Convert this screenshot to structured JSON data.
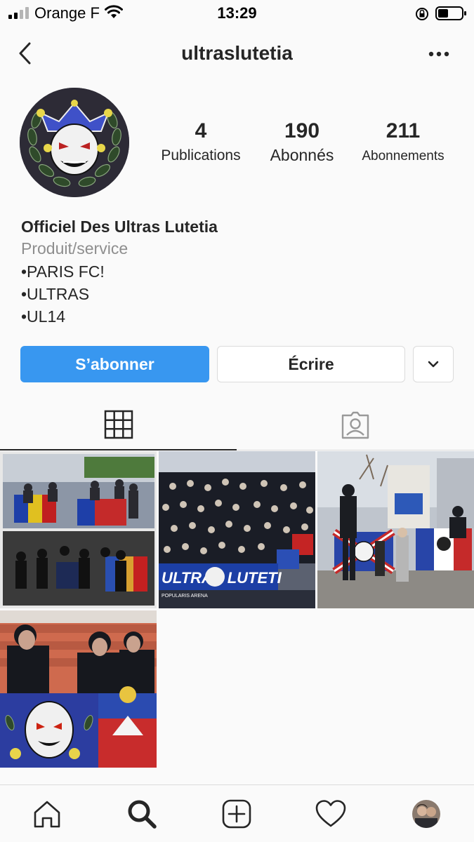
{
  "status_bar": {
    "carrier": "Orange F",
    "time": "13:29"
  },
  "header": {
    "username": "ultraslutetia"
  },
  "profile": {
    "stats": [
      {
        "value": "4",
        "label": "Publications"
      },
      {
        "value": "190",
        "label": "Abonnés"
      },
      {
        "value": "211",
        "label": "Abonnements"
      }
    ],
    "name": "Officiel Des Ultras Lutetia",
    "category": "Produit/service",
    "bio_lines": [
      "•PARIS FC!",
      "•ULTRAS",
      "•UL14"
    ]
  },
  "actions": {
    "follow_label": "S’abonner",
    "message_label": "Écrire"
  },
  "posts": {
    "post_2_banner_text": "ULTRAS LUTETI",
    "post_2_banner_subtext": "POPULARIS ARENA"
  },
  "colors": {
    "accent": "#3897f0",
    "border": "#dbdbdb",
    "text": "#262626",
    "muted": "#8e8e8e"
  },
  "icons": {
    "back": "chevron-left-icon",
    "more": "more-horizontal-icon",
    "grid_tab": "grid-icon",
    "tagged_tab": "tagged-person-icon",
    "home": "home-icon",
    "search": "search-icon",
    "add": "add-post-icon",
    "activity": "heart-icon"
  }
}
